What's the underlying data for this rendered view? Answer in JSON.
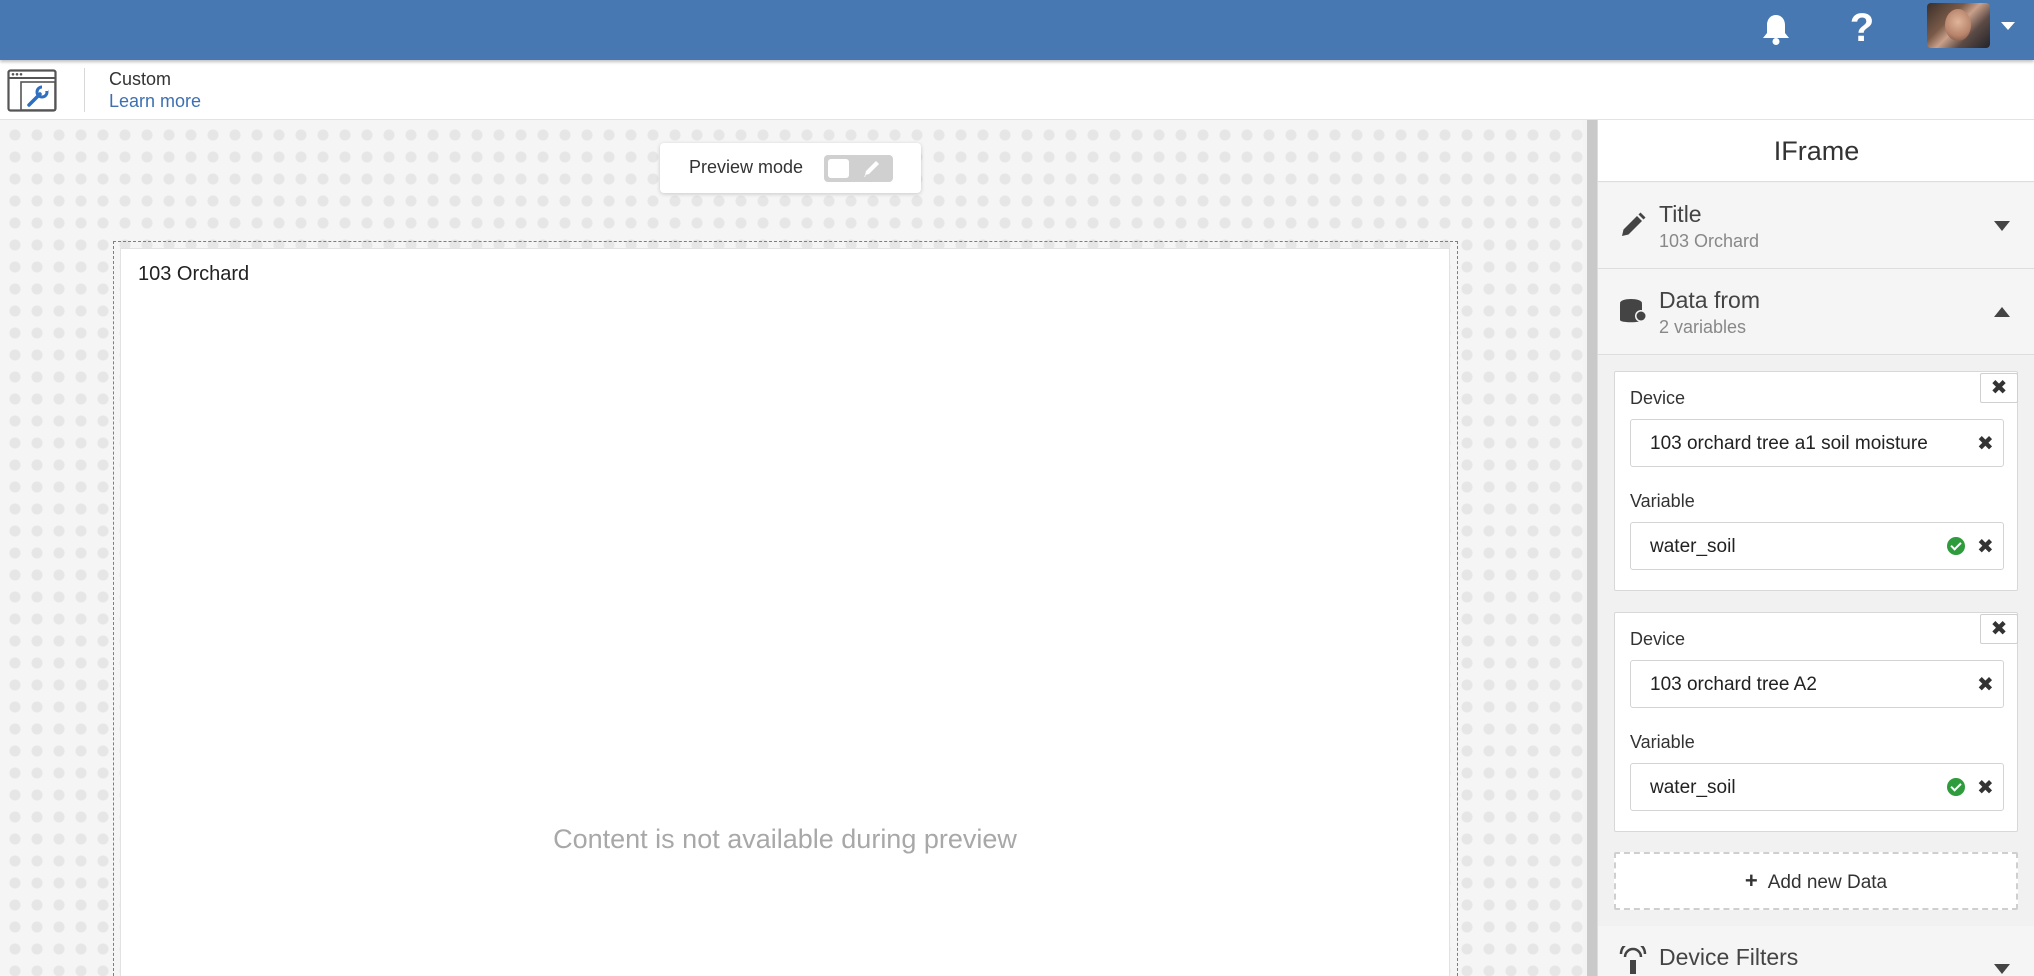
{
  "topbar": {
    "help_label": "?",
    "icons": [
      "bell-icon",
      "help-icon",
      "avatar",
      "caret-down-icon"
    ],
    "color": "#4778b2"
  },
  "subheader": {
    "title": "Custom",
    "learn_more": "Learn more",
    "icon": "custom-widget-icon"
  },
  "canvas": {
    "preview_label": "Preview mode",
    "widget_title": "103 Orchard",
    "unavailable_text": "Content is not available during preview"
  },
  "panel": {
    "title": "IFrame",
    "title_section": {
      "name": "Title",
      "value": "103 Orchard",
      "icon": "pencil-icon"
    },
    "data_section": {
      "name": "Data from",
      "value": "2 variables",
      "icon": "database-icon"
    },
    "data_items": [
      {
        "device_label": "Device",
        "device_value": "103 orchard tree a1 soil moisture",
        "variable_label": "Variable",
        "variable_value": "water_soil"
      },
      {
        "device_label": "Device",
        "device_value": "103 orchard tree A2",
        "variable_label": "Variable",
        "variable_value": "water_soil"
      }
    ],
    "remove_glyph": "✖",
    "add_new": "Add new Data",
    "add_plus": "+",
    "filters_section": {
      "name": "Device Filters",
      "icon": "device-filter-icon"
    }
  }
}
